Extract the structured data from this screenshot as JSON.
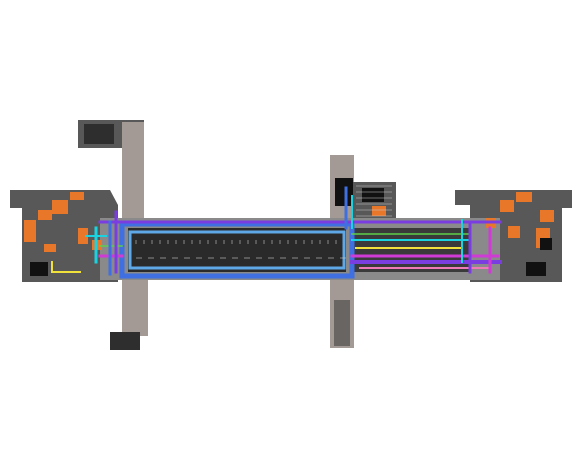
{
  "colors": {
    "background": "#ffffff",
    "wall": "#585858",
    "wall_light": "#8a8a8a",
    "corridor": "#a39a95",
    "floor_dark": "#2a2a2a",
    "orange": "#e8772a",
    "blue": "#3f6fe0",
    "light_blue": "#5ea8e8",
    "cyan": "#19d3e0",
    "purple": "#7a3ee0",
    "magenta": "#d03bd6",
    "yellow": "#f0e23a",
    "green": "#5fd04a",
    "pink": "#f07ab8",
    "grey_line": "#c9c9c9"
  }
}
